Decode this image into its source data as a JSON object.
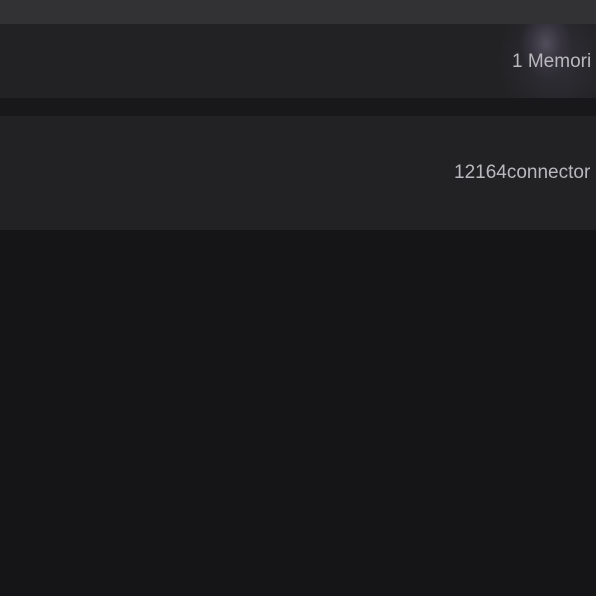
{
  "cards": {
    "memories": {
      "label": "1 Memori"
    },
    "connector": {
      "label": "12164connector"
    }
  }
}
